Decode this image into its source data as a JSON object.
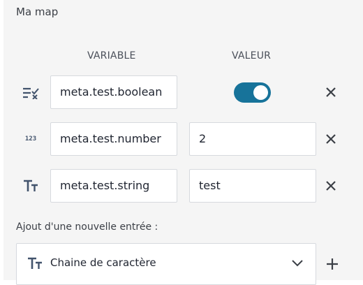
{
  "panel": {
    "title": "Ma map"
  },
  "table": {
    "headers": {
      "variable": "VARIABLE",
      "value": "VALEUR"
    },
    "rows": [
      {
        "type_icon": "boolean-type-icon",
        "variable": "meta.test.boolean",
        "value_kind": "toggle",
        "value_on": true
      },
      {
        "type_icon": "number-type-icon",
        "type_icon_text": "123",
        "variable": "meta.test.number",
        "value": "2"
      },
      {
        "type_icon": "string-type-icon",
        "variable": "meta.test.string",
        "value": "test"
      }
    ]
  },
  "add_entry": {
    "label": "Ajout d'une nouvelle entrée :",
    "selected_type": "Chaine de caractère",
    "add_icon": "plus-icon"
  },
  "colors": {
    "accent": "#17739a",
    "panel_bg": "#f5f5f5",
    "icon": "#42536c"
  }
}
